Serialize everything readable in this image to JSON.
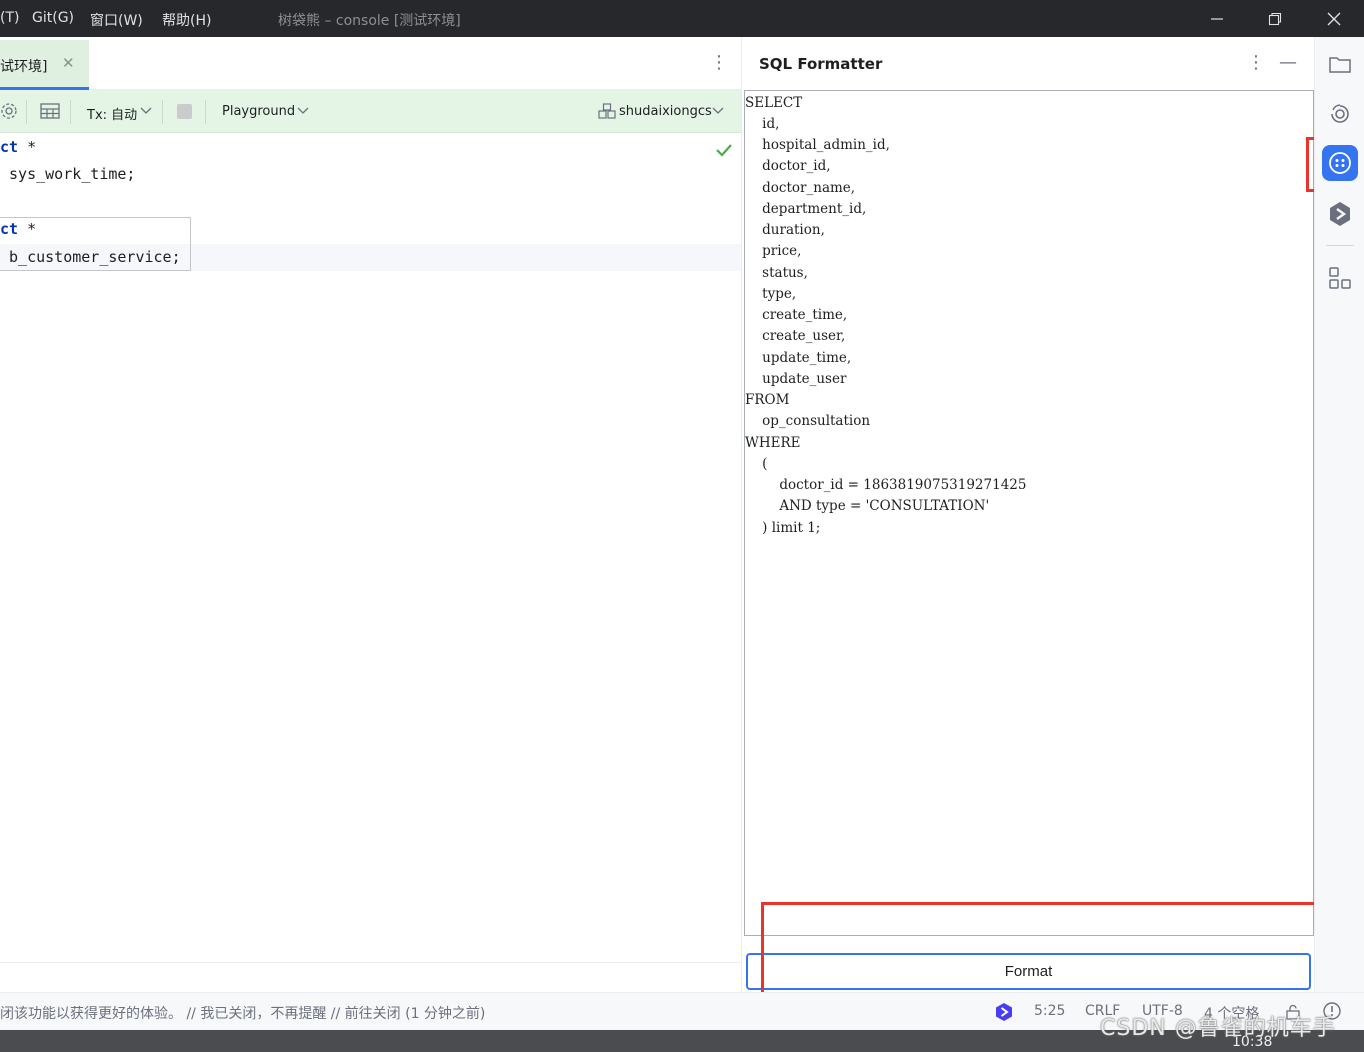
{
  "titlebar": {
    "menus": [
      "(T)",
      "Git(G)",
      "窗口(W)",
      "帮助(H)"
    ],
    "title": "树袋熊 – console [测试环境]"
  },
  "editor": {
    "tab_label": "试环境]",
    "toolbar": {
      "tx_label": "Tx: 自动",
      "playground_label": "Playground",
      "datasource_label": "shudaixiongcs"
    },
    "code_lines": [
      {
        "kw": "ct",
        "rest": " *"
      },
      {
        "kw": "",
        "rest": " sys_work_time;"
      },
      {
        "kw": "",
        "rest": ""
      },
      {
        "kw": "ct",
        "rest": " *"
      },
      {
        "kw": "",
        "rest": " b_customer_service;"
      }
    ]
  },
  "sql_formatter": {
    "title": "SQL Formatter",
    "output_lines": [
      "SELECT",
      "    id,",
      "    hospital_admin_id,",
      "    doctor_id,",
      "    doctor_name,",
      "    department_id,",
      "    duration,",
      "    price,",
      "    status,",
      "    type,",
      "    create_time,",
      "    create_user,",
      "    update_time,",
      "    update_user",
      "FROM",
      "    op_consultation",
      "WHERE",
      "    (",
      "        doctor_id = 1863819075319271425",
      "        AND type = 'CONSULTATION'",
      "    ) limit 1;"
    ],
    "format_button": "Format"
  },
  "stripe_icons": [
    "folder-icon",
    "ai-assistant-icon",
    "sql-formatter-icon",
    "plugin-hex-icon",
    "structure-icon"
  ],
  "statusbar": {
    "message": "闭该功能以获得更好的体验。 // 我已关闭，不再提醒 // 前往关闭 (1 分钟之前)",
    "position": "5:25",
    "line_ending": "CRLF",
    "encoding": "UTF-8",
    "indent": "4 个空格"
  },
  "watermark": "CSDN @鲁雀的机车手",
  "taskbar": {
    "clock": "10:38"
  },
  "colors": {
    "accent": "#3574f0",
    "highlight_box": "#e8342a",
    "toolbar_green": "#e4f5e5",
    "keyword": "#0033b3"
  }
}
